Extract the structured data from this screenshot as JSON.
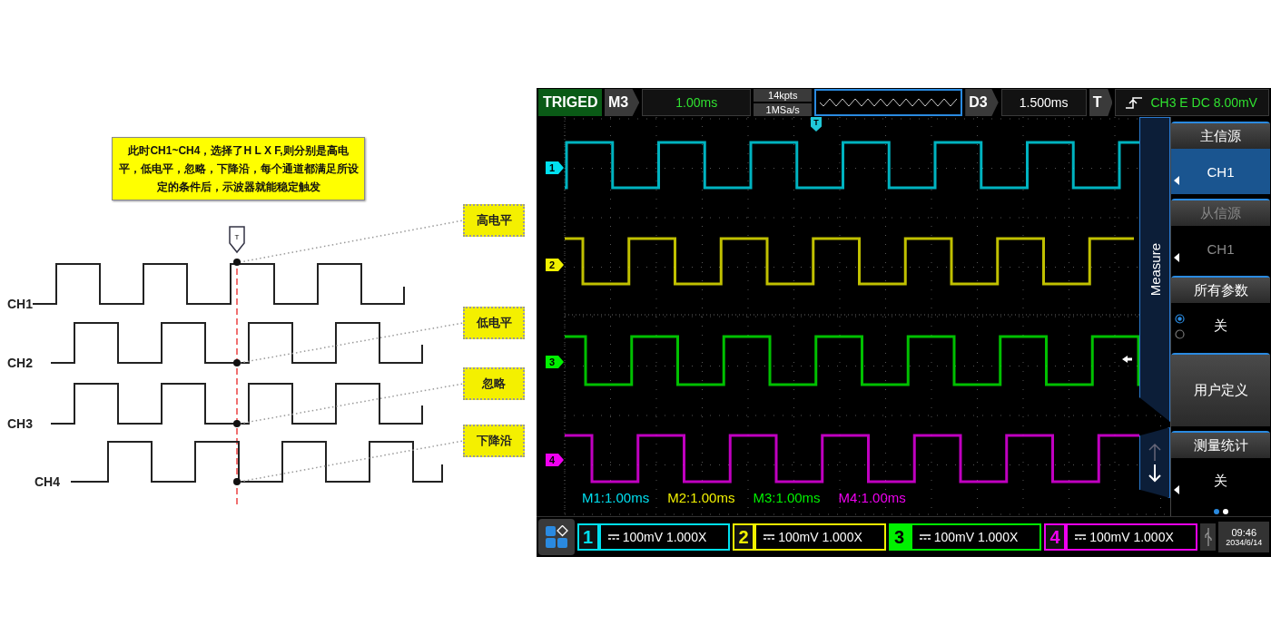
{
  "diagram": {
    "note": "此时CH1~CH4，选择了H L X F,则分别是高电平，低电平，忽略，下降沿，每个通道都满足所设定的条件后，示波器就能稳定触发",
    "trigger_marker": "T",
    "channels": [
      {
        "label": "CH1",
        "condition": "高电平"
      },
      {
        "label": "CH2",
        "condition": "低电平"
      },
      {
        "label": "CH3",
        "condition": "忽略"
      },
      {
        "label": "CH4",
        "condition": "下降沿"
      }
    ]
  },
  "scope": {
    "status": "TRIGED",
    "timebase": {
      "label": "M3",
      "value": "1.00ms"
    },
    "memory": {
      "depth": "14kpts",
      "rate": "1MSa/s"
    },
    "delay": {
      "label": "D3",
      "value": "1.500ms"
    },
    "trigger": {
      "label": "T",
      "info": "CH3 E DC 8.00mV"
    },
    "trigger_marker": "T",
    "channels": [
      {
        "marker": "1",
        "number": "1",
        "color": "#00e0f0",
        "measurement": "M1:1.00ms",
        "scale": "100mV 1.000X",
        "selected": false
      },
      {
        "marker": "2",
        "number": "2",
        "color": "#f0f000",
        "measurement": "M2:1.00ms",
        "scale": "100mV 1.000X",
        "selected": false
      },
      {
        "marker": "3",
        "number": "3",
        "color": "#00f000",
        "measurement": "M3:1.00ms",
        "scale": "100mV 1.000X",
        "selected": true
      },
      {
        "marker": "4",
        "number": "4",
        "color": "#f000f0",
        "measurement": "M4:1.00ms",
        "scale": "100mV 1.000X",
        "selected": false
      }
    ],
    "side_tab": "Measure",
    "menu": [
      {
        "kind": "select",
        "title": "主信源",
        "value": "CH1",
        "selected": true,
        "disabled": false
      },
      {
        "kind": "select",
        "title": "从信源",
        "value": "CH1",
        "selected": false,
        "disabled": true
      },
      {
        "kind": "radio",
        "title": "所有参数",
        "value": "关",
        "options": [
          {
            "selected": true
          },
          {
            "selected": false
          }
        ]
      },
      {
        "kind": "button",
        "title": "用户定义"
      },
      {
        "kind": "select",
        "title": "测量统计",
        "value": "关",
        "selected": false,
        "disabled": false
      }
    ],
    "pages": [
      {
        "selected": true
      },
      {
        "selected": false
      }
    ],
    "clock": {
      "time": "09:46",
      "date": "2034/6/14"
    }
  }
}
